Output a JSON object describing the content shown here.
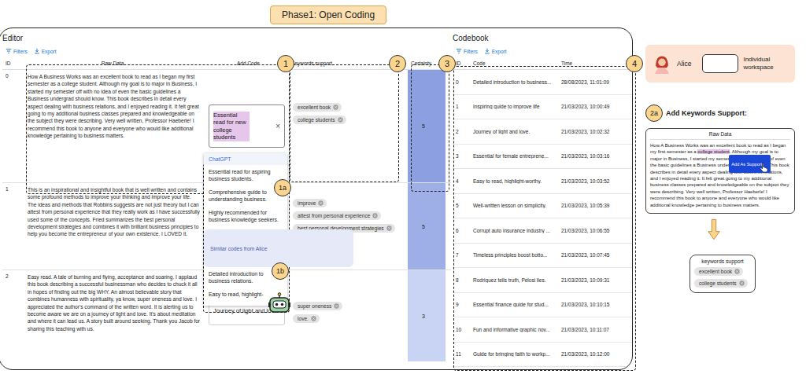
{
  "phase_label": "Phase1: Open Coding",
  "annotations": [
    "1",
    "1a",
    "1b",
    "2",
    "3",
    "4"
  ],
  "editor": {
    "title": "Editor",
    "toolbar": [
      "Filters",
      "Export"
    ],
    "columns": [
      "ID",
      "Raw Data",
      "Add Code",
      "Keywords support",
      "Certainty"
    ],
    "clear_icon": "×",
    "rows": [
      {
        "id": "0",
        "raw": "How A Business Works was an excellent book to read as I began my first semester as a college student. Although my goal is to major in Business, I started my semester off with no idea of even the basic guidelines a Business undergrad should know. This book describes in detail every aspect dealing with business relations, and I enjoyed reading it. It felt great going to my additional business classes prepared and knowledgeable on the subject they were describing. Very well written, Professor Haeberle! I recommend this book to anyone and everyone who would like additional knowledge pertaining to business matters.",
        "code": "Essential read for new college students",
        "editing": true,
        "keywords": [
          "excellent book",
          "college students"
        ],
        "certainty": "5",
        "color": "#8c9fe0"
      },
      {
        "id": "1",
        "raw": "This is an inspirational and insightful book that is well written and contains some profound methods to improve your thinking and improve your life. The ideas and methods that Robbins suggests are not just theory but I can attest from personal experience that they really work as I have successfully used some of the concepts. Fried summarizes the best personal development strategies and combines it with brilliant business principles to help you become the entrepreneur of your own existence. I LOVED it.",
        "code": "",
        "editing": false,
        "keywords": [
          "improve",
          "attest from personal experience",
          "best personal development strategies"
        ],
        "certainty": "5",
        "color": "#9eafe7"
      },
      {
        "id": "2",
        "raw": "Easy read. A tale of burning and flying, acceptance and soaring. I applaud this book describing a successful businessman who decides to chuck it all in hopes of finding out the big WHY. An almost believable story that combines humanness with spirituality, ya know, super oneness and love. I appreciated the author's command of the written word. It is alerting us to become aware we are on a journey of light and love. It's about meditation and where it can lead us. A story built around seeking. Thank you Jacob for sharing this teaching with us.",
        "code": "Journey of light and love.",
        "editing": false,
        "keywords": [
          "super oneness",
          "love."
        ],
        "certainty": "3",
        "color": "#c9d3f3"
      }
    ]
  },
  "suggestions": [
    {
      "title": "ChatGPT",
      "items": [
        "Essential read for aspiring business students.",
        "Comprehensive guide to understanding business.",
        "Highly recommended for business knowledge seekers."
      ]
    },
    {
      "title": "Similar codes from Alice",
      "items": [
        "Detailed introduction to business relations.",
        "Easy to read, highlight-"
      ]
    }
  ],
  "codebook": {
    "title": "Codebook",
    "toolbar": [
      "Filters",
      "Export"
    ],
    "columns": [
      "ID",
      "Code",
      "Time"
    ],
    "rows": [
      {
        "id": "0",
        "code": "Detailed introduction to business...",
        "time": "28/08/2023, 11:01:09"
      },
      {
        "id": "1",
        "code": "Inspiring guide to improve life",
        "time": "21/03/2023, 10:00:49"
      },
      {
        "id": "2",
        "code": "Journey of light and love.",
        "time": "21/03/2023, 10:02:32"
      },
      {
        "id": "3",
        "code": "Essential for female entreprene...",
        "time": "21/03/2023, 10:03:16"
      },
      {
        "id": "4",
        "code": "Easy to read, highlight-worthy.",
        "time": "21/03/2023, 10:03:52"
      },
      {
        "id": "5",
        "code": "Well-written lesson on simplicity.",
        "time": "21/03/2023, 10:05:39"
      },
      {
        "id": "6",
        "code": "Corrupt auto insurance industry ...",
        "time": "21/03/2023, 10:06:55"
      },
      {
        "id": "7",
        "code": "Timeless principles boost botto...",
        "time": "21/03/2023, 10:07:45"
      },
      {
        "id": "8",
        "code": "Rodriguez tells truth, Pelosi lies.",
        "time": "21/03/2023, 10:09:31"
      },
      {
        "id": "9",
        "code": "Essential finance guide for stud...",
        "time": "21/03/2023, 10:10:15"
      },
      {
        "id": "10",
        "code": "Fun and informative graphic nov...",
        "time": "21/03/2023, 10:11:07"
      },
      {
        "id": "11",
        "code": "Guide for bringing faith to workp...",
        "time": "21/03/2023, 10:12:00"
      }
    ]
  },
  "workspace": {
    "user": "Alice",
    "label": "Individual workspace"
  },
  "keyword_demo": {
    "step": "2a",
    "title": "Add Keywords Support:",
    "panel_header": "Raw Data",
    "text": "How A Business Works was an excellent book to read as I began my first semester as a college student. Although my goal is to major in Business, I started my semester off with no idea of even the basic guidelines a Business undergrad should know. This book describes in detail every aspect dealing with business relations, and I enjoyed reading it. It felt great going to my additional business classes prepared and knowledgeable on the subject they were describing. Very well written, Professor Haeberle! I recommend this book to anyone and everyone who would like additional knowledge pertaining to business matters.",
    "highlight": "college student",
    "tooltip": "Add As Support",
    "result_title": "keywords support",
    "result_keywords": [
      "excellent book",
      "college students"
    ]
  }
}
